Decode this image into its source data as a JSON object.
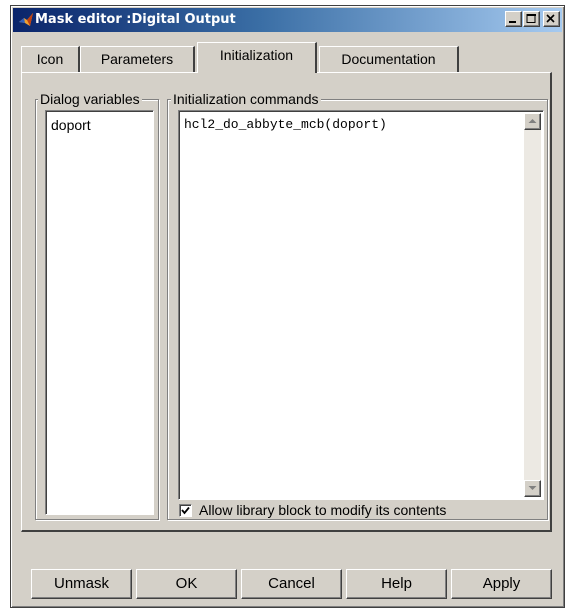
{
  "window": {
    "title": "Mask editor :Digital Output"
  },
  "tabs": [
    {
      "label": "Icon"
    },
    {
      "label": "Parameters"
    },
    {
      "label": "Initialization",
      "active": true
    },
    {
      "label": "Documentation"
    }
  ],
  "dialog_variables": {
    "legend": "Dialog variables",
    "items": [
      "doport"
    ]
  },
  "init_commands": {
    "legend": "Initialization commands",
    "text": "hcl2_do_abbyte_mcb(doport)"
  },
  "allow_modify": {
    "label": "Allow library block to modify its contents",
    "checked": true
  },
  "buttons": {
    "unmask": "Unmask",
    "ok": "OK",
    "cancel": "Cancel",
    "help": "Help",
    "apply": "Apply"
  },
  "colors": {
    "titlebar_start": "#0a246a",
    "titlebar_end": "#a6caf0",
    "dialog_face": "#d4d0c8"
  }
}
